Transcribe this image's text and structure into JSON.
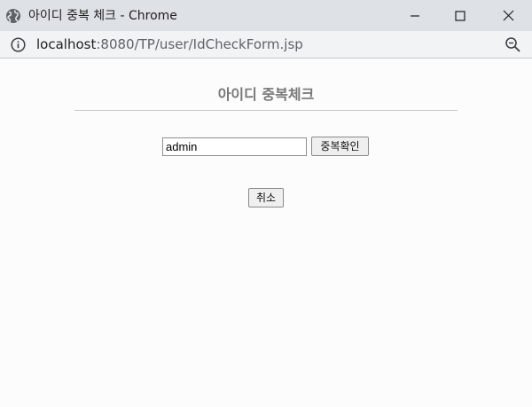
{
  "window": {
    "title": "아이디 중복 체크 - Chrome",
    "icons": {
      "site": "globe-icon",
      "minimize": "minimize-icon",
      "maximize": "maximize-icon",
      "close": "close-icon"
    }
  },
  "address_bar": {
    "host": "localhost",
    "path": ":8080/TP/user/IdCheckForm.jsp",
    "icons": {
      "info": "info-icon",
      "zoom": "zoom-icon"
    }
  },
  "page": {
    "heading": "아이디 중복체크",
    "id_input": {
      "value": "admin"
    },
    "check_button": "중복확인",
    "cancel_button": "취소"
  },
  "colors": {
    "titlebar_bg": "#dee1e6",
    "addressbar_bg": "#f1f3f4",
    "page_bg": "#fdfcfd",
    "heading_text": "#777777"
  }
}
